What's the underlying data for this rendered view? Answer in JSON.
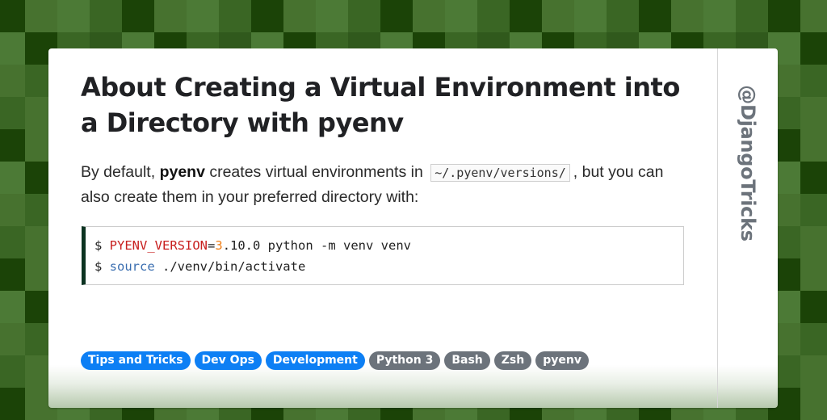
{
  "card": {
    "title": "About Creating a Virtual Environment into a Directory with pyenv",
    "intro": {
      "before": "By default, ",
      "bold": "pyenv",
      "middle": " creates virtual environments in ",
      "code": "~/.pyenv/versions/",
      "after": ", but you can also create them in your preferred directory with:"
    },
    "code_block": {
      "lines": [
        {
          "prompt": "$ ",
          "var": "PYENV_VERSION",
          "eq": "=",
          "num": "3",
          "rest": ".10.0 python -m venv venv"
        },
        {
          "prompt": "$ ",
          "keyword": "source",
          "rest": " ./venv/bin/activate"
        }
      ]
    },
    "tags": [
      {
        "label": "Tips and Tricks",
        "style": "primary"
      },
      {
        "label": "Dev Ops",
        "style": "primary"
      },
      {
        "label": "Development",
        "style": "primary"
      },
      {
        "label": "Python 3",
        "style": "secondary"
      },
      {
        "label": "Bash",
        "style": "secondary"
      },
      {
        "label": "Zsh",
        "style": "secondary"
      },
      {
        "label": "pyenv",
        "style": "secondary"
      }
    ],
    "handle": "@DjangoTricks"
  },
  "colors": {
    "tag_primary": "#0d7ff4",
    "tag_secondary": "#6c737b",
    "code_accent": "#0c3321",
    "code_var": "#c8201f",
    "code_number": "#f07f19",
    "code_keyword": "#3a6eb0",
    "background_greens": [
      "#47722f",
      "#4c7a36",
      "#3a6624",
      "#1b4307",
      "#30591c",
      "#416c2a"
    ]
  }
}
